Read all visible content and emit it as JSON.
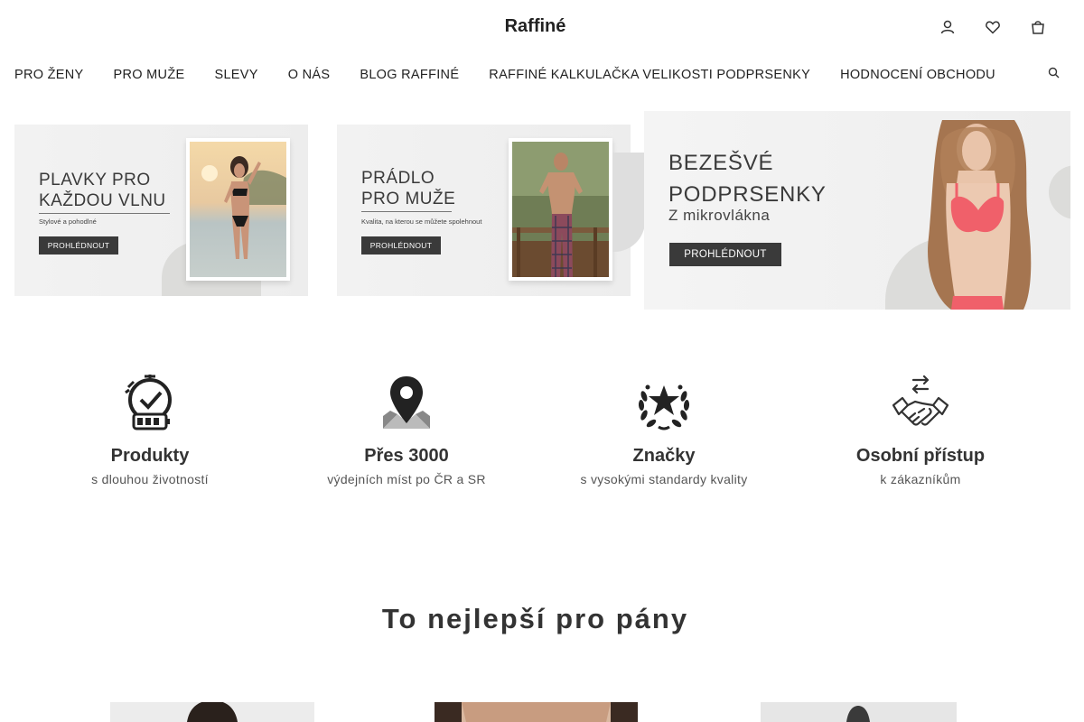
{
  "header": {
    "logo": "Raffiné",
    "icons": [
      "user-icon",
      "heart-icon",
      "cart-icon"
    ]
  },
  "nav": {
    "items": [
      "PRO ŽENY",
      "PRO MUŽE",
      "SLEVY",
      "O NÁS",
      "BLOG RAFFINÉ",
      "RAFFINÉ KALKULAČKA VELIKOSTI PODPRSENKY",
      "HODNOCENÍ OBCHODU"
    ],
    "search_icon": "search-icon"
  },
  "banners": [
    {
      "title": "PLAVKY PRO\nKAŽDOU VLNU",
      "subtitle": "Stylové a pohodlné",
      "button": "PROHLÉDNOUT"
    },
    {
      "title": "PRÁDLO\nPRO MUŽE",
      "subtitle": "Kvalita, na kterou se můžete spolehnout",
      "button": "PROHLÉDNOUT"
    },
    {
      "title": "BEZEŠVÉ\nPODPRSENKY",
      "subtitle": "Z mikrovlákna",
      "button": "PROHLÉDNOUT"
    }
  ],
  "features": [
    {
      "icon": "timer-battery-icon",
      "title": "Produkty",
      "subtitle": "s dlouhou životností"
    },
    {
      "icon": "map-pin-icon",
      "title": "Přes 3000",
      "subtitle": "výdejních míst po ČR a SR"
    },
    {
      "icon": "laurel-star-icon",
      "title": "Značky",
      "subtitle": "s vysokými standardy kvality"
    },
    {
      "icon": "handshake-icon",
      "title": "Osobní přístup",
      "subtitle": "k zákazníkům"
    }
  ],
  "section": {
    "title": "To nejlepší pro pány"
  },
  "colors": {
    "text": "#222222",
    "banner_bg": "#f0f0f0",
    "button_bg": "#3a3a3a",
    "bra_color": "#f0606a"
  }
}
